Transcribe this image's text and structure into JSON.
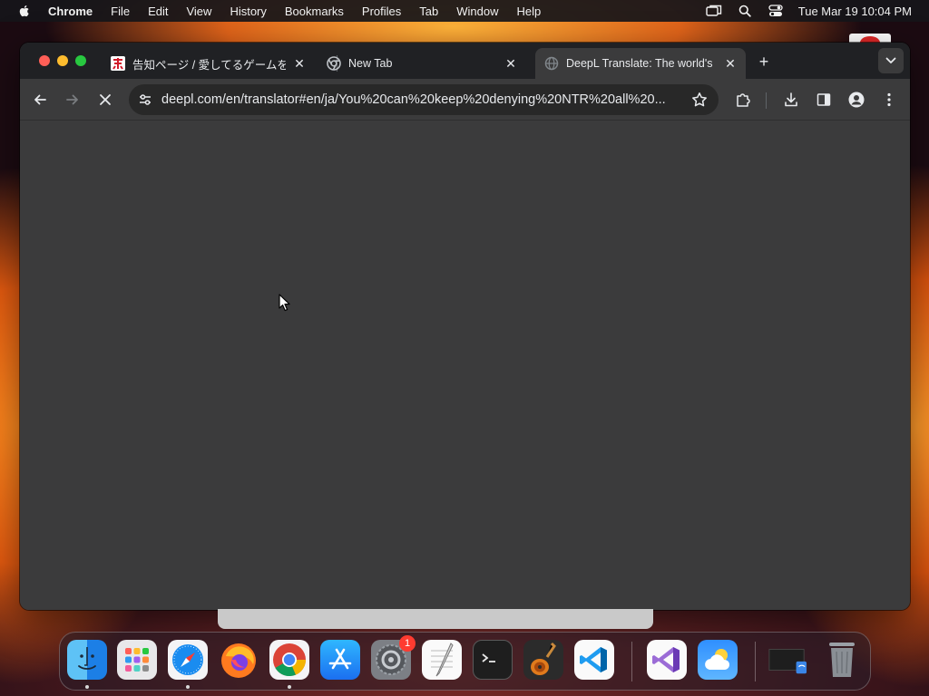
{
  "menubar": {
    "app_name": "Chrome",
    "items": [
      "File",
      "Edit",
      "View",
      "History",
      "Bookmarks",
      "Profiles",
      "Tab",
      "Window",
      "Help"
    ],
    "clock": "Tue Mar 19  10:04 PM",
    "status_icons": [
      "screen-mirroring-icon",
      "spotlight-search-icon",
      "control-center-icon"
    ]
  },
  "browser": {
    "tabs": [
      {
        "title": "告知ページ / 愛してるゲームを",
        "favicon": "site-favicon",
        "active": false
      },
      {
        "title": "New Tab",
        "favicon": "chrome-icon",
        "active": false
      },
      {
        "title": "DeepL Translate: The world's",
        "favicon": "loading-globe-icon",
        "active": true
      }
    ],
    "new_tab_symbol": "+",
    "address_bar": {
      "url": "deepl.com/en/translator#en/ja/You%20can%20keep%20denying%20NTR%20all%20..."
    },
    "colors": {
      "tabstrip": "#202124",
      "toolbar": "#3b3b3c",
      "content": "#3b3b3c"
    }
  },
  "dock": {
    "items": [
      {
        "name": "finder-icon",
        "running": true
      },
      {
        "name": "launchpad-icon",
        "running": false
      },
      {
        "name": "safari-icon",
        "running": true
      },
      {
        "name": "firefox-icon",
        "running": false
      },
      {
        "name": "chrome-icon",
        "running": true
      },
      {
        "name": "app-store-icon",
        "running": false
      },
      {
        "name": "system-settings-icon",
        "running": false,
        "badge": "1"
      },
      {
        "name": "textedit-icon",
        "running": false
      },
      {
        "name": "terminal-icon",
        "running": false
      },
      {
        "name": "garageband-icon",
        "running": false
      },
      {
        "name": "vscode-icon",
        "running": false
      },
      {
        "name": "visual-studio-icon",
        "running": false
      },
      {
        "name": "weather-icon",
        "running": false
      },
      {
        "name": "downloads-stack-icon",
        "running": false
      },
      {
        "name": "trash-icon",
        "running": false
      }
    ]
  }
}
